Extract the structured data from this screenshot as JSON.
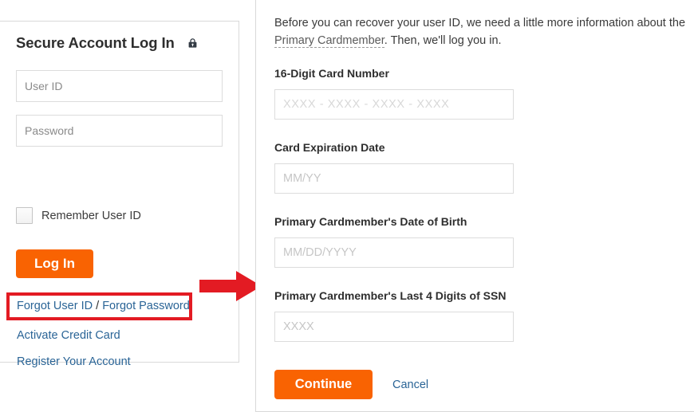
{
  "login_panel": {
    "title": "Secure Account Log In",
    "lock_icon": "padlock-icon",
    "userid_placeholder": "User ID",
    "password_placeholder": "Password",
    "remember_label": "Remember User ID",
    "login_button": "Log In",
    "links": {
      "forgot_userid": "Forgot User ID",
      "separator": " / ",
      "forgot_password": "Forgot Password",
      "activate": "Activate Credit Card",
      "register": "Register Your Account"
    },
    "highlight_color": "#e31b23",
    "button_color": "#f96302",
    "link_color": "#2a6496"
  },
  "annotation": {
    "arrow_icon": "right-arrow-icon",
    "arrow_color": "#e31b23"
  },
  "recover_panel": {
    "intro_line1": "Before you can recover your user ID, we need a little more information about the ",
    "intro_term": "Primary Cardmember",
    "intro_line2": ". Then, we'll log you in.",
    "fields": [
      {
        "label": "16-Digit Card Number",
        "placeholder": "XXXX - XXXX - XXXX - XXXX",
        "value": ""
      },
      {
        "label": "Card Expiration Date",
        "placeholder": "MM/YY",
        "value": ""
      },
      {
        "label": "Primary Cardmember's Date of Birth",
        "placeholder": "MM/DD/YYYY",
        "value": ""
      },
      {
        "label": "Primary Cardmember's Last 4 Digits of SSN",
        "placeholder": "XXXX",
        "value": ""
      }
    ],
    "continue_button": "Continue",
    "cancel_link": "Cancel"
  }
}
